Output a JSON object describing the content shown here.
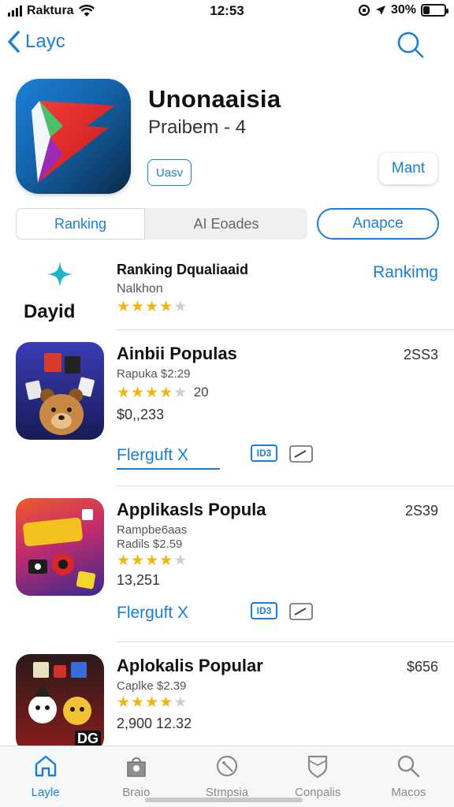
{
  "status": {
    "carrier": "Raktura",
    "time": "12:53",
    "battery": "30%",
    "battery_level": 0.3
  },
  "nav": {
    "back_label": "Layc",
    "search_label": "q"
  },
  "app": {
    "title": "Unonaaisia",
    "subtitle": "Praibem - 4",
    "small_button": "Uasv",
    "get_button": "Mant"
  },
  "segments": {
    "items": [
      "Ranking",
      "AI Eoades"
    ],
    "pill": "Anapce"
  },
  "ranking": {
    "side_label": "Dayid",
    "title": "Ranking Dqualiaaid",
    "subtitle": "Nalkhon",
    "rating_stars": 3.5,
    "link": "Rankimg"
  },
  "list": [
    {
      "title": "Ainbii Populas",
      "price": "2SS3",
      "line1": "Rapuka $2:29",
      "line2": "",
      "rating_stars": 4,
      "rating_text": "20",
      "count": "$0,,233",
      "action": "Flerguft X",
      "tag": "ID3",
      "colors": {
        "bg_top": "#3b3bb7",
        "bg_bottom": "#171c55",
        "mascot": "#c98844"
      }
    },
    {
      "title": "Applikasls Popula",
      "price": "2S39",
      "line1": "Rampbe6aas",
      "line2": "Radils $2.59",
      "rating_stars": 3.5,
      "rating_text": "",
      "count": "13,251",
      "action": "Flerguft X",
      "tag": "ID3",
      "colors": {
        "bg_top": "#f05a2a",
        "bg_bottom": "#3a2a8c",
        "mascot": "#e6c422"
      }
    },
    {
      "title": "Aplokalis Popular",
      "price": "$656",
      "line1": "Caplke $2.39",
      "line2": "",
      "rating_stars": 3.5,
      "rating_text": "",
      "count": "2,900 12.32",
      "action": "",
      "tag": "",
      "corner_badge": "DG",
      "colors": {
        "bg_top": "#2b1a1a",
        "bg_bottom": "#8a1c1c",
        "mascot": "#f2c234"
      }
    }
  ],
  "tabbar": {
    "tabs": [
      {
        "label": "Layle",
        "icon": "home-icon",
        "active": true
      },
      {
        "label": "Braio",
        "icon": "bag-icon",
        "active": false
      },
      {
        "label": "Stmpsia",
        "icon": "compass-icon",
        "active": false
      },
      {
        "label": "Conpalis",
        "icon": "shield-icon",
        "active": false
      },
      {
        "label": "Macos",
        "icon": "search-icon",
        "active": false
      }
    ]
  },
  "colors": {
    "accent": "#1a7fd4",
    "star": "#f2b413",
    "brand_red": "#e0332e"
  }
}
